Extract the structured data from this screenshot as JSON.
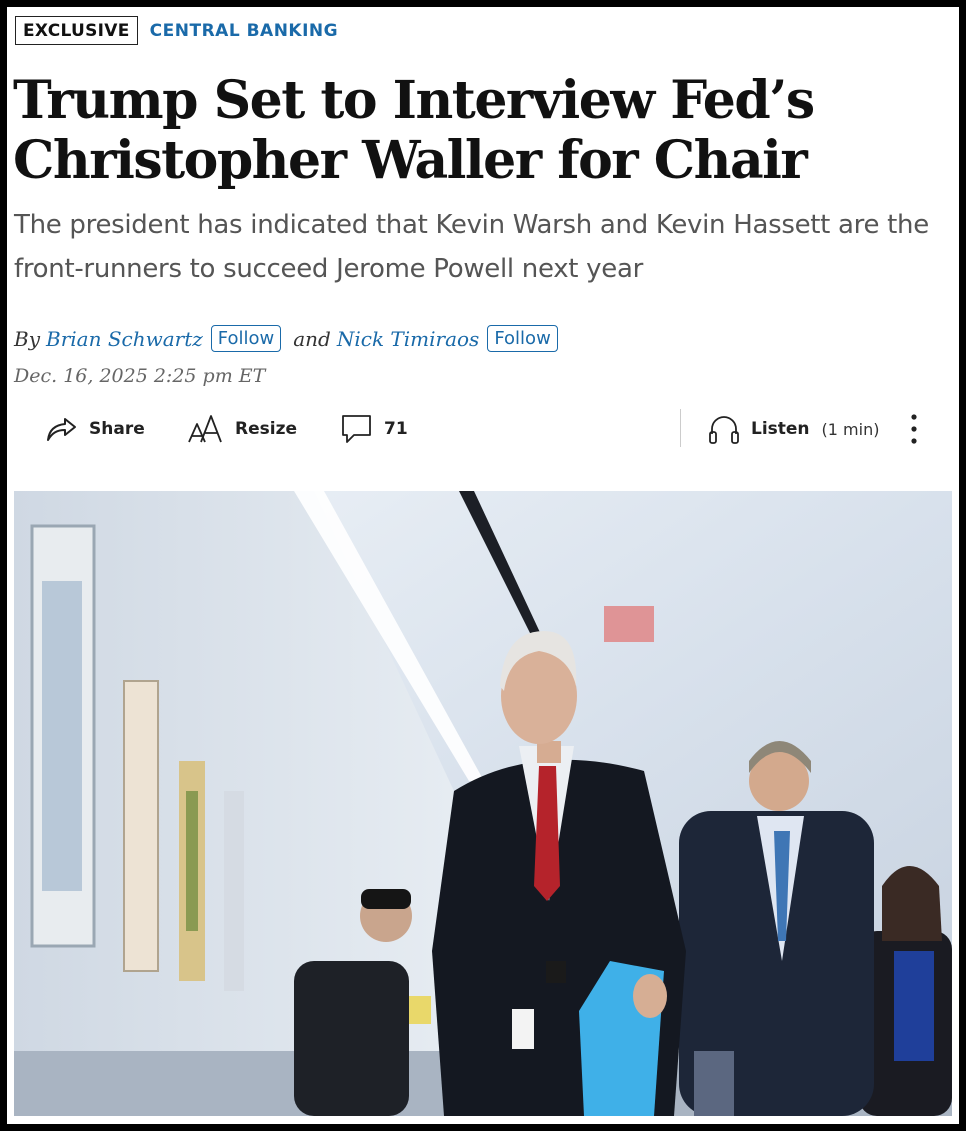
{
  "article": {
    "tag": "EXCLUSIVE",
    "section": "CENTRAL BANKING",
    "headline": "Trump Set to Interview Fed’s Christopher Waller for Chair",
    "dek": "The president has indicated that Kevin Warsh and Kevin Hassett are the front-runners to succeed Jerome Powell next year",
    "byline": {
      "by": "By",
      "author1": "Brian Schwartz",
      "and": "and",
      "author2": "Nick Timiraos",
      "follow": "Follow"
    },
    "date": "Dec. 16, 2025 2:25 pm ET"
  },
  "toolbar": {
    "share": "Share",
    "resize": "Resize",
    "comments": "71",
    "listen": "Listen",
    "listen_duration": "(1 min)"
  },
  "colors": {
    "accent": "#1a6aa9",
    "headline": "#111111",
    "dek": "#555555"
  },
  "icons": [
    "share-icon",
    "resize-icon",
    "comment-icon",
    "headphones-icon",
    "more-icon"
  ]
}
